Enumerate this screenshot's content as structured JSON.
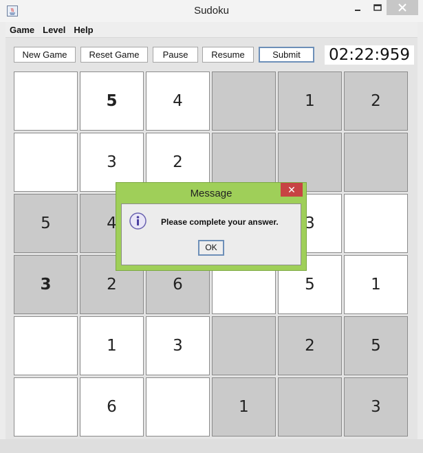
{
  "window": {
    "title": "Sudoku",
    "controls": {
      "minimize": "—",
      "maximize": "☐",
      "close": "✕"
    }
  },
  "menu": [
    "Game",
    "Level",
    "Help"
  ],
  "toolbar": {
    "new_game": "New Game",
    "reset_game": "Reset Game",
    "pause": "Pause",
    "resume": "Resume",
    "submit": "Submit",
    "timer": "02:22:959"
  },
  "board": {
    "size": 6,
    "cells": [
      [
        {
          "v": "",
          "g": false,
          "f": false
        },
        {
          "v": "5",
          "g": false,
          "f": true
        },
        {
          "v": "4",
          "g": false,
          "f": false
        },
        {
          "v": "",
          "g": true,
          "f": false
        },
        {
          "v": "1",
          "g": true,
          "f": false
        },
        {
          "v": "2",
          "g": true,
          "f": false
        }
      ],
      [
        {
          "v": "",
          "g": false,
          "f": false
        },
        {
          "v": "3",
          "g": false,
          "f": false
        },
        {
          "v": "2",
          "g": false,
          "f": false
        },
        {
          "v": "",
          "g": true,
          "f": false
        },
        {
          "v": "",
          "g": true,
          "f": false
        },
        {
          "v": "",
          "g": true,
          "f": false
        }
      ],
      [
        {
          "v": "5",
          "g": true,
          "f": false
        },
        {
          "v": "4",
          "g": true,
          "f": false
        },
        {
          "v": "",
          "g": true,
          "f": false
        },
        {
          "v": "",
          "g": false,
          "f": false
        },
        {
          "v": "3",
          "g": false,
          "f": false
        },
        {
          "v": "",
          "g": false,
          "f": false
        }
      ],
      [
        {
          "v": "3",
          "g": true,
          "f": true
        },
        {
          "v": "2",
          "g": true,
          "f": false
        },
        {
          "v": "6",
          "g": true,
          "f": false
        },
        {
          "v": "",
          "g": false,
          "f": false
        },
        {
          "v": "5",
          "g": false,
          "f": false
        },
        {
          "v": "1",
          "g": false,
          "f": false
        }
      ],
      [
        {
          "v": "",
          "g": false,
          "f": false
        },
        {
          "v": "1",
          "g": false,
          "f": false
        },
        {
          "v": "3",
          "g": false,
          "f": false
        },
        {
          "v": "",
          "g": true,
          "f": false
        },
        {
          "v": "2",
          "g": true,
          "f": false
        },
        {
          "v": "5",
          "g": true,
          "f": false
        }
      ],
      [
        {
          "v": "",
          "g": false,
          "f": false
        },
        {
          "v": "6",
          "g": false,
          "f": false
        },
        {
          "v": "",
          "g": false,
          "f": false
        },
        {
          "v": "1",
          "g": true,
          "f": false
        },
        {
          "v": "",
          "g": true,
          "f": false
        },
        {
          "v": "3",
          "g": true,
          "f": false
        }
      ]
    ]
  },
  "dialog": {
    "title": "Message",
    "close": "✕",
    "message": "Please complete your answer.",
    "ok": "OK",
    "icon": "info-icon"
  }
}
